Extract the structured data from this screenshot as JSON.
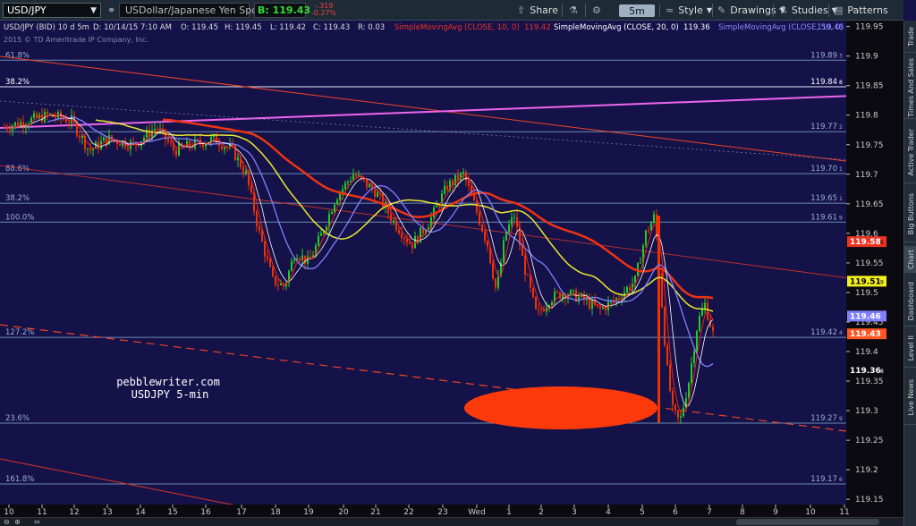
{
  "toolbar": {
    "symbol": "USD/JPY",
    "description": "USDollar/Japanese Yen Spot",
    "last": "B: 119.43",
    "change": "-.319",
    "change_pct": "-0.27%",
    "share": "Share",
    "aggregation": "5m",
    "style": "Style",
    "drawings": "Drawings",
    "studies": "Studies",
    "patterns": "Patterns",
    "icons": {
      "link": "link-icon",
      "share": "share-icon",
      "flask": "flask-icon",
      "gear": "gear-icon"
    }
  },
  "legend": {
    "symbol_info": "USD/JPY (BID) 10 d 5m",
    "datetime": "D: 10/14/15 7:10 AM",
    "open": "O: 119.45",
    "high": "H: 119.45",
    "low": "L: 119.42",
    "close": "C: 119.43",
    "range": "R: 0.03",
    "sma10": "SimpleMovingAvg (CLOSE, 10, 0)",
    "sma10_val": "119.42",
    "sma20": "SimpleMovingAvg (CLOSE, 20, 0)",
    "sma20_val": "119.36",
    "sma50": "SimpleMovingAvg (CLOSE, 50, 0)",
    "sma50_val": "119.46",
    "copyright": "2015 © TD Ameritrade IP Company, Inc."
  },
  "annotation": {
    "line1": "pebblewriter.com",
    "line2": "USDJPY 5-min"
  },
  "chart_data": {
    "type": "candlestick",
    "ylim": [
      119.12,
      119.96
    ],
    "y_ticks": [
      "119.95",
      "119.9",
      "119.85",
      "119.8",
      "119.75",
      "119.7",
      "119.65",
      "119.6",
      "119.55",
      "119.5",
      "119.45",
      "119.4",
      "119.35",
      "119.3",
      "119.25",
      "119.2",
      "119.15"
    ],
    "x_ticks": [
      "10",
      "11",
      "12",
      "13",
      "14",
      "15",
      "16",
      "17",
      "18",
      "19",
      "20",
      "21",
      "22",
      "23",
      "Wed",
      "1",
      "2",
      "3",
      "4",
      "5",
      "6",
      "7",
      "8",
      "9",
      "10",
      "11"
    ],
    "fib_levels": [
      {
        "pct": "61.8%",
        "value": "119.89",
        "sub": "3",
        "price": 119.893
      },
      {
        "pct": "38.2%",
        "value": "119.84",
        "sub": "8",
        "price": 119.848
      },
      {
        "pct": "",
        "value": "119.77",
        "sub": "2",
        "price": 119.772
      },
      {
        "pct": "88.6%",
        "value": "119.70",
        "sub": "1",
        "price": 119.701
      },
      {
        "pct": "38.2%",
        "value": "119.65",
        "sub": "1",
        "price": 119.651
      },
      {
        "pct": "100.0%",
        "value": "119.61",
        "sub": "9",
        "price": 119.619
      },
      {
        "pct": "127.2%",
        "value": "119.42",
        "sub": "4",
        "price": 119.424
      },
      {
        "pct": "23.6%",
        "value": "119.27",
        "sub": "9",
        "price": 119.279
      },
      {
        "pct": "161.8%",
        "value": "119.17",
        "sub": "6",
        "price": 119.176
      }
    ],
    "price_tags": [
      {
        "value": "119.58",
        "sub": "6",
        "price": 119.586,
        "color": "#ee3322"
      },
      {
        "value": "119.51",
        "sub": "9",
        "price": 119.519,
        "color": "#f0f020"
      },
      {
        "value": "119.46",
        "sub": "",
        "price": 119.46,
        "color": "#8080ff"
      },
      {
        "value": "119.43",
        "sub": "",
        "price": 119.43,
        "color": "#ff5522"
      },
      {
        "value": "119.36",
        "sub": "8",
        "price": 119.368,
        "color": "#ffffff"
      }
    ],
    "series": [
      {
        "name": "SimpleMovingAvg (CLOSE, 10, 0)",
        "color": "#ee2222"
      },
      {
        "name": "SimpleMovingAvg (CLOSE, 20, 0)",
        "color": "#ffffff"
      },
      {
        "name": "SimpleMovingAvg (CLOSE, 50, 0)",
        "color": "#8080ff"
      }
    ],
    "colors": {
      "bg": "#15124a",
      "up": "#22cc22",
      "down": "#ee3300",
      "fib": "#6a8bb0",
      "sma200": "#ee3311",
      "sma100": "#e8e830"
    }
  },
  "sidetabs": [
    "Trade",
    "Times And Sales",
    "Active Trader",
    "Big Buttons",
    "Chart",
    "Dashboard",
    "Level II",
    "Live News"
  ],
  "bottombar": {
    "icons": [
      "zoom-out-icon",
      "zoom-in-icon",
      "expand-icon"
    ]
  }
}
